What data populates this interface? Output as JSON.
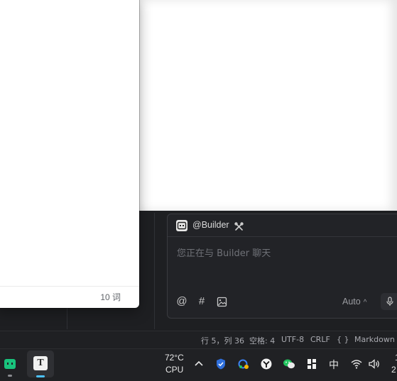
{
  "document": {
    "word_count": "10 词"
  },
  "chat": {
    "agent_name": "@Builder",
    "input_placeholder": "您正在与 Builder 聊天",
    "tools": {
      "mention": "@",
      "hash": "#"
    },
    "mode": "Auto"
  },
  "status_bar": {
    "position": "行 5，列 36",
    "indent": "空格: 4",
    "encoding": "UTF-8",
    "line_ending": "CRLF",
    "braces": "{ }",
    "language": "Markdown"
  },
  "taskbar": {
    "weather_temp": "72°C",
    "weather_label": "CPU",
    "ime": "中",
    "clock_time": "1",
    "clock_date": "2"
  },
  "icons": {
    "terminal": "terminal-app-icon",
    "typora": "typora-app-icon",
    "builder": "builder-agent-icon",
    "tools": "tools-icon",
    "image": "image-icon",
    "mic": "microphone-icon",
    "tray_chevron": "chevron-up-icon",
    "tray_defender": "shield-icon",
    "tray_cloud": "cloud-sync-icon",
    "tray_app": "tray-app-icon",
    "tray_wechat": "wechat-icon",
    "tray_windows": "windows-app-icon",
    "wifi": "wifi-icon",
    "volume": "volume-icon"
  }
}
